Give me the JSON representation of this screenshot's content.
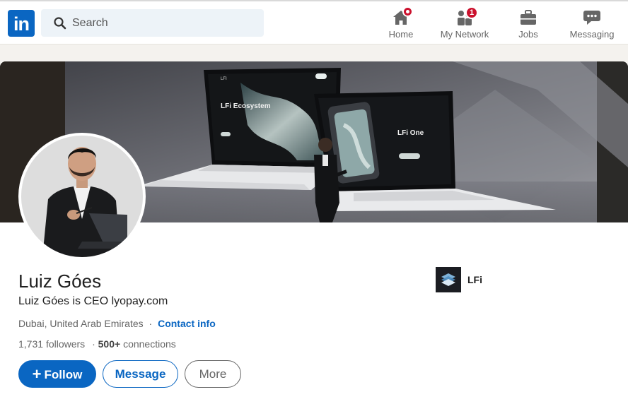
{
  "nav": {
    "logo_text": "in",
    "search": {
      "placeholder": "Search"
    },
    "items": [
      {
        "label": "Home",
        "icon": "home-icon",
        "badge": "dot"
      },
      {
        "label": "My Network",
        "icon": "network-icon",
        "badge": "1"
      },
      {
        "label": "Jobs",
        "icon": "briefcase-icon"
      },
      {
        "label": "Messaging",
        "icon": "chat-icon"
      }
    ],
    "brand_color": "#0a66c2",
    "badge_color": "#cb112d"
  },
  "banner": {
    "slide_left_title": "LFi Ecosystem",
    "slide_right_title": "LFi One",
    "slide_logo": "LFI"
  },
  "profile": {
    "name": "Luiz Góes",
    "headline": "Luiz Góes is CEO lyopay.com",
    "location": "Dubai, United Arab Emirates",
    "separator": "·",
    "contact_info": "Contact info",
    "followers_count": "1,731",
    "followers_label": "followers",
    "connections_count": "500+",
    "connections_label": "connections"
  },
  "company": {
    "name": "LFi",
    "icon": "lfi-logo"
  },
  "actions": {
    "follow": "Follow",
    "follow_icon": "+",
    "message": "Message",
    "more": "More"
  }
}
